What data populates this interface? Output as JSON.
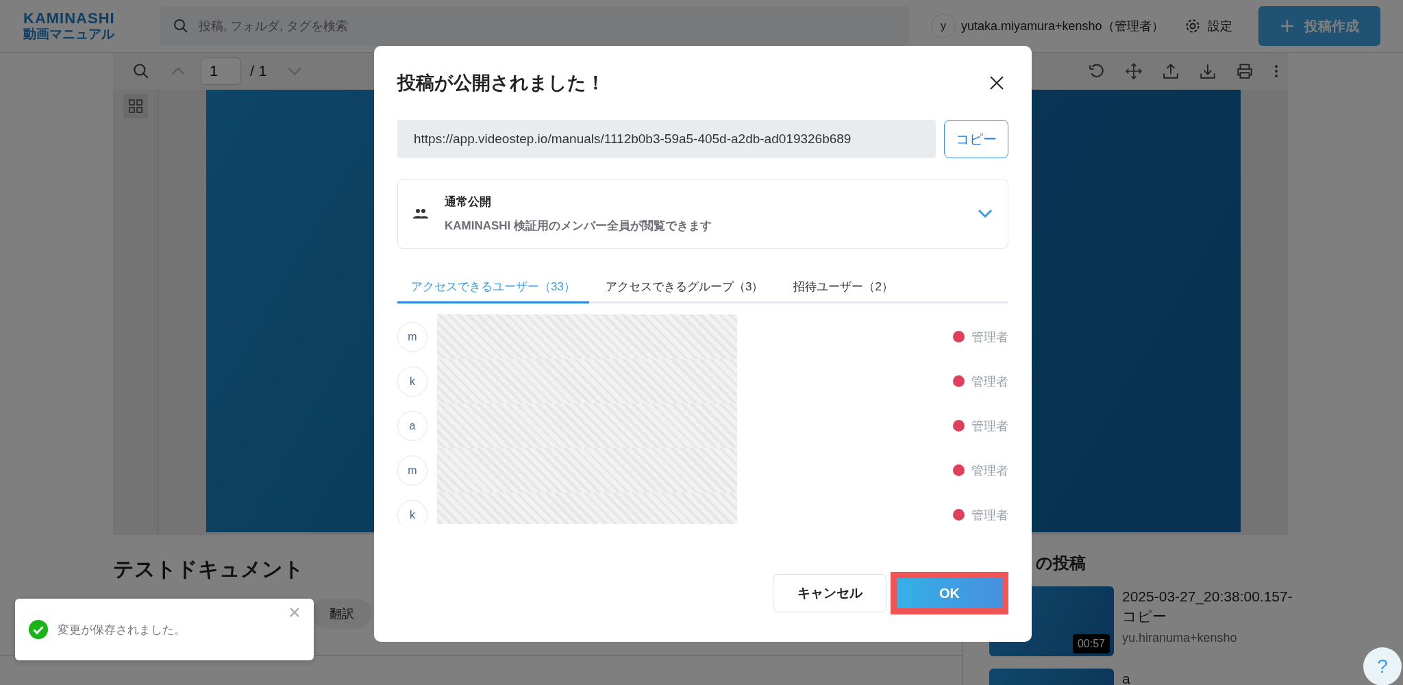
{
  "header": {
    "logo_top": "KAMINASHI",
    "logo_bottom": "動画マニュアル",
    "search": {
      "placeholder": "投稿, フォルダ, タグを検索"
    },
    "user": {
      "initial": "y",
      "name": "yutaka.miyamura+kensho（管理者）"
    },
    "settings": "設定",
    "create_button": "投稿作成"
  },
  "viewer": {
    "page_input": "1",
    "page_total": "/ 1"
  },
  "document": {
    "title": "テストドキュメント",
    "translate_button": "翻訳"
  },
  "related": {
    "heading": "の投稿",
    "posts": [
      {
        "title": "2025-03-27_20:38:00.157-コピー",
        "duration": "00:57",
        "author": "yu.hiranuma+kensho"
      },
      {
        "title": "a"
      }
    ]
  },
  "dialog": {
    "title": "投稿が公開されました！",
    "url": "https://app.videostep.io/manuals/1112b0b3-59a5-405d-a2db-ad019326b689",
    "copy_button": "コピー",
    "visibility": {
      "label": "通常公開",
      "description": "KAMINASHI 検証用のメンバー全員が閲覧できます",
      "expanded": false
    },
    "tabs": [
      {
        "label": "アクセスできるユーザー（33）",
        "selected": true
      },
      {
        "label": "アクセスできるグループ（3）",
        "selected": false
      },
      {
        "label": "招待ユーザー（2）",
        "selected": false
      }
    ],
    "members": [
      {
        "initial": "m",
        "role": "管理者"
      },
      {
        "initial": "k",
        "role": "管理者"
      },
      {
        "initial": "a",
        "role": "管理者"
      },
      {
        "initial": "m",
        "role": "管理者"
      },
      {
        "initial": "k",
        "role": "管理者"
      }
    ],
    "cancel_button": "キャンセル",
    "ok_button": {
      "label": "OK",
      "highlighted": true
    }
  },
  "toast": {
    "message": "変更が保存されました。"
  },
  "help_button": "?"
}
